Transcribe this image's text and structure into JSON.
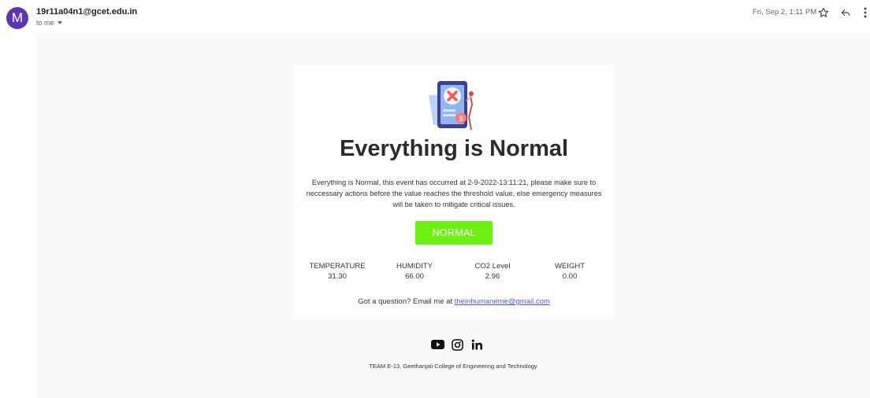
{
  "header": {
    "avatar_letter": "M",
    "sender": "19r11a04n1@gcet.edu.in",
    "recipient": "to me",
    "date": "Fri, Sep 2, 1:11 PM"
  },
  "email": {
    "headline": "Everything is Normal",
    "description": "Everything is Normal, this event has occurred at 2-9-2022-13:11:21, please make sure to neccessary actions before the value reaches the threshold value, else emergency measures will be taken to mitigate critical issues.",
    "status_label": "NORMAL",
    "status_color": "#6ef013",
    "metrics": [
      {
        "label": "TEMPERATURE",
        "value": "31.30"
      },
      {
        "label": "HUMIDITY",
        "value": "66.00"
      },
      {
        "label": "CO2 Level",
        "value": "2.96"
      },
      {
        "label": "WEIGHT",
        "value": "0.00"
      }
    ],
    "contact_prefix": "Got a question? Email me at ",
    "contact_email": "theinhumaneme@gmail.com",
    "socials": [
      "youtube-icon",
      "instagram-icon",
      "linkedin-icon"
    ],
    "footer": "TEAM E-13, Geethanjali College of Engineering and Technology"
  },
  "colors": {
    "avatar": "#5e35b1",
    "link": "#4a5ae8",
    "canvas": "#f9f9f9"
  }
}
